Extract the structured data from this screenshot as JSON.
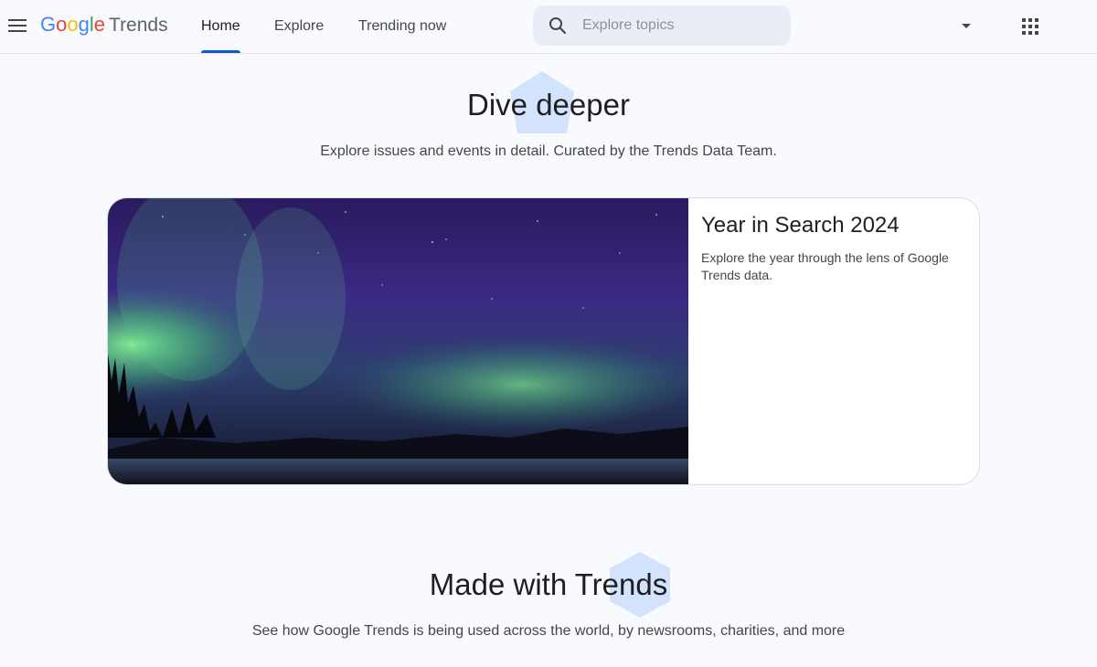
{
  "header": {
    "logo_google": [
      "G",
      "o",
      "o",
      "g",
      "l",
      "e"
    ],
    "logo_product": "Trends",
    "nav": [
      {
        "label": "Home",
        "active": true
      },
      {
        "label": "Explore",
        "active": false
      },
      {
        "label": "Trending now",
        "active": false
      }
    ],
    "search": {
      "placeholder": "Explore topics",
      "value": ""
    },
    "icons": {
      "menu": "menu-icon",
      "search": "search-icon",
      "dropdown": "arrow-drop-down-icon",
      "apps": "apps-grid-icon"
    }
  },
  "dive": {
    "title": "Dive deeper",
    "subtitle": "Explore issues and events in detail. Curated by the Trends Data Team."
  },
  "featured_card": {
    "title": "Year in Search 2024",
    "description": "Explore the year through the lens of Google Trends data.",
    "image_subject": "aurora-borealis-over-lake"
  },
  "made_with": {
    "title": "Made with Trends",
    "subtitle": "See how Google Trends is being used across the world, by newsrooms, charities, and more"
  },
  "colors": {
    "accent": "#0b57d0",
    "background": "#f8fafd",
    "hex_decoration": "#d3e3fd",
    "google_blue": "#4285f4",
    "google_red": "#ea4335",
    "google_yellow": "#fbbc05",
    "google_green": "#34a853"
  }
}
